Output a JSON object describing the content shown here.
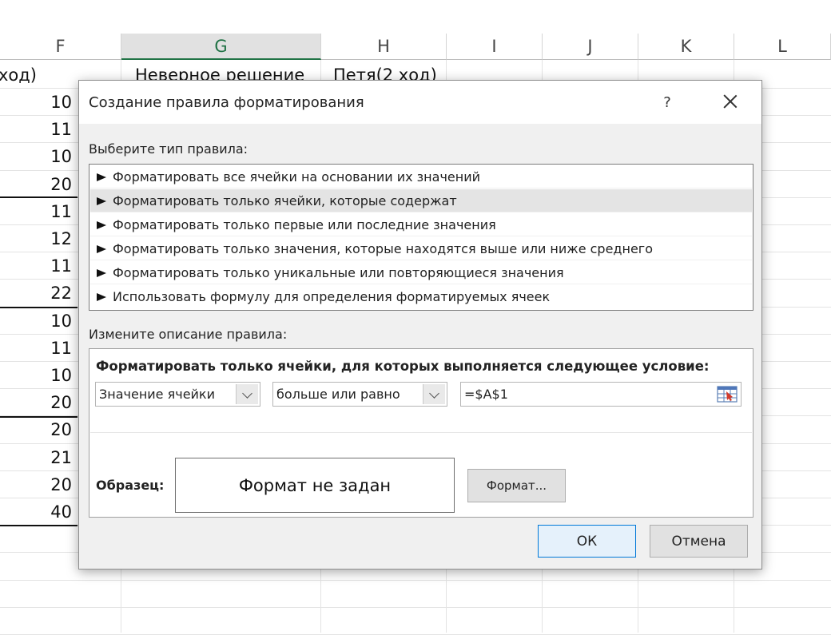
{
  "sheet": {
    "columns": [
      "F",
      "G",
      "H",
      "I",
      "J",
      "K",
      "L"
    ],
    "selected_column": "G",
    "row1_f": "ход)",
    "row1_g": "Неверное решение",
    "row1_h": "Петя(2 ход)",
    "f_values": [
      "10",
      "11",
      "10",
      "20",
      "11",
      "12",
      "11",
      "22",
      "10",
      "11",
      "10",
      "20",
      "20",
      "21",
      "20",
      "40"
    ]
  },
  "dialog": {
    "title": "Создание правила форматирования",
    "help": "?",
    "select_rule_label": "Выберите тип правила:",
    "rules": [
      "Форматировать все ячейки на основании их значений",
      "Форматировать только ячейки, которые содержат",
      "Форматировать только первые или последние значения",
      "Форматировать только значения, которые находятся выше или ниже среднего",
      "Форматировать только уникальные или повторяющиеся значения",
      "Использовать формулу для определения форматируемых ячеек"
    ],
    "selected_rule_index": 1,
    "edit_desc_label": "Измените описание правила:",
    "condition_heading": "Форматировать только ячейки, для которых выполняется следующее условие:",
    "combo1_value": "Значение ячейки",
    "combo2_value": "больше или равно",
    "formula_value": "=$A$1",
    "preview_label": "Образец:",
    "preview_text": "Формат не задан",
    "format_button": "Формат...",
    "ok_button": "ОК",
    "cancel_button": "Отмена"
  },
  "colors": {
    "selected_column_accent": "#217346",
    "ok_border": "#0078d7"
  }
}
